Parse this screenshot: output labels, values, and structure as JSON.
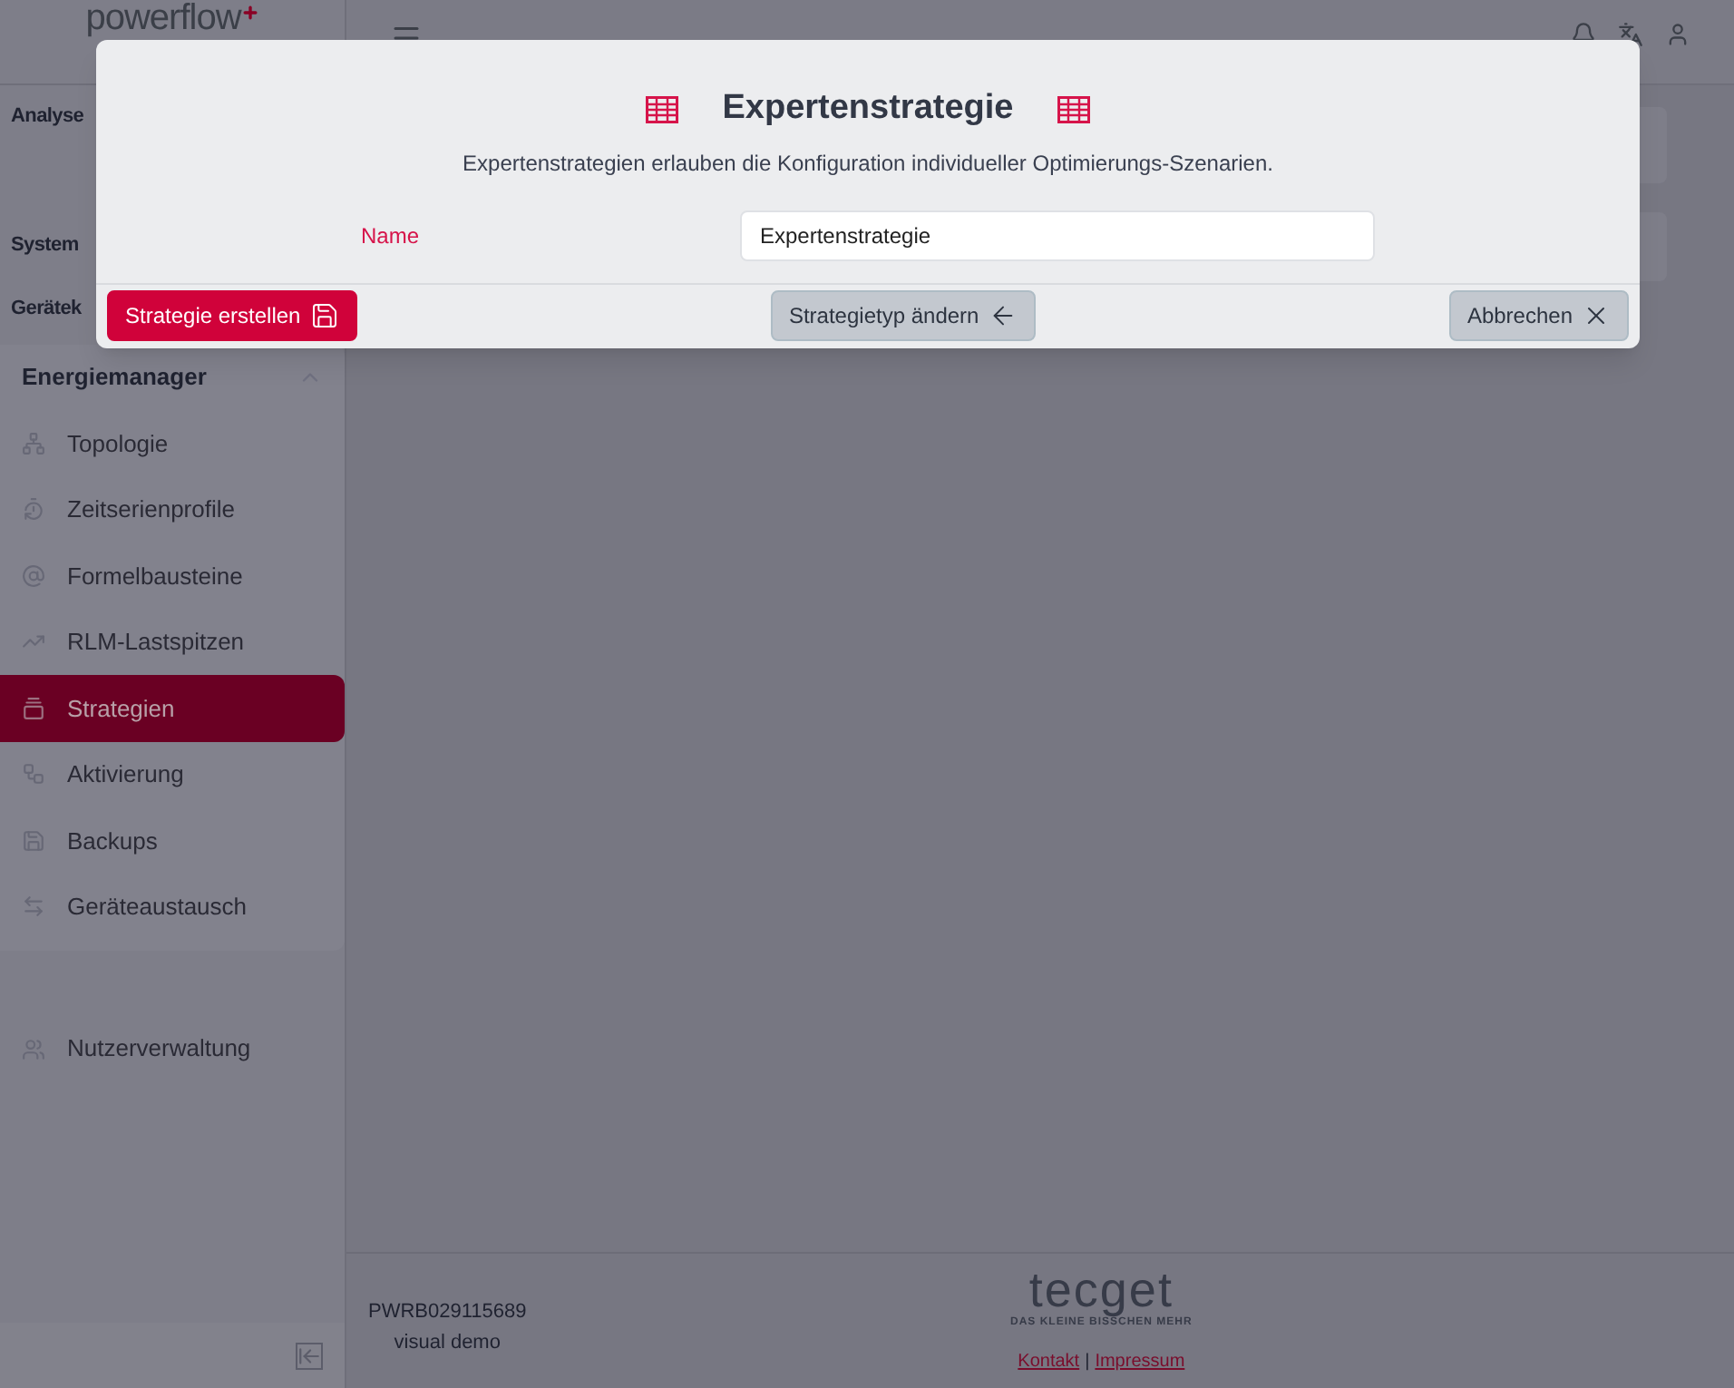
{
  "app": {
    "logo": "powerflow"
  },
  "sidebar": {
    "sections": [
      {
        "label": "Analyse"
      },
      {
        "label": "System"
      },
      {
        "label": "Gerätek"
      }
    ],
    "group": {
      "label": "Energiemanager",
      "expanded": true,
      "items": [
        {
          "label": "Topologie",
          "selected": false
        },
        {
          "label": "Zeitserienprofile",
          "selected": false
        },
        {
          "label": "Formelbausteine",
          "selected": false
        },
        {
          "label": "RLM-Lastspitzen",
          "selected": false
        },
        {
          "label": "Strategien",
          "selected": true
        },
        {
          "label": "Aktivierung",
          "selected": false
        },
        {
          "label": "Backups",
          "selected": false
        },
        {
          "label": "Geräteaustausch",
          "selected": false
        }
      ]
    },
    "bottom_items": [
      {
        "label": "Nutzerverwaltung"
      }
    ]
  },
  "footer": {
    "serial": "PWRB029115689",
    "mode": "visual demo",
    "brand": "tecget",
    "tagline": "DAS KLEINE BISSCHEN MEHR",
    "links": [
      "Kontakt",
      "Impressum"
    ],
    "separator": "|"
  },
  "modal": {
    "title": "Expertenstrategie",
    "subtitle": "Expertenstrategien erlauben die Konfiguration individueller Optimierungs-Szenarien.",
    "field": {
      "label": "Name",
      "value": "Expertenstrategie"
    },
    "buttons": [
      {
        "kind": "primary",
        "label": "Strategie erstellen"
      },
      {
        "kind": "back",
        "label": "Strategietyp ändern"
      },
      {
        "kind": "cancel",
        "label": "Abbrechen"
      }
    ]
  }
}
